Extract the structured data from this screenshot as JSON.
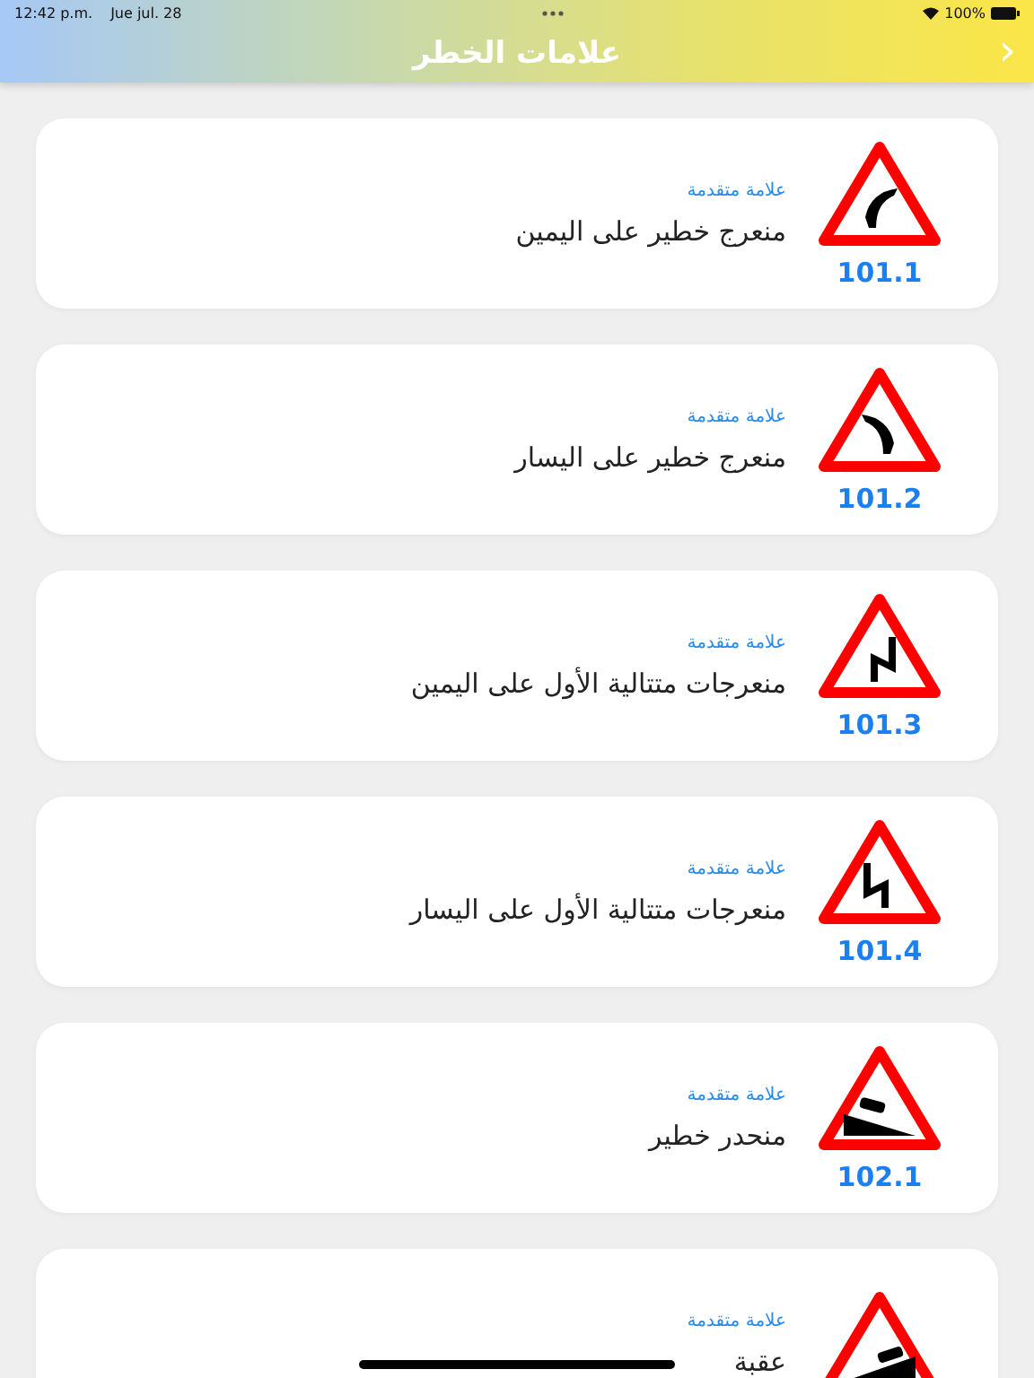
{
  "status_bar": {
    "time": "12:42 p.m.",
    "date": "Jue jul. 28",
    "battery": "100%"
  },
  "nav": {
    "title": "علامات الخطر",
    "back": "›"
  },
  "signs": [
    {
      "kind": "curve-right",
      "tag": "علامة متقدمة",
      "title": "منعرج خطير على اليمين",
      "code": "101.1"
    },
    {
      "kind": "curve-left",
      "tag": "علامة متقدمة",
      "title": "منعرج خطير على اليسار",
      "code": "101.2"
    },
    {
      "kind": "double-right",
      "tag": "علامة متقدمة",
      "title": "منعرجات متتالية الأول على اليمين",
      "code": "101.3"
    },
    {
      "kind": "double-left",
      "tag": "علامة متقدمة",
      "title": "منعرجات متتالية الأول على اليسار",
      "code": "101.4"
    },
    {
      "kind": "descent",
      "tag": "علامة متقدمة",
      "title": "منحدر خطير",
      "code": "102.1"
    },
    {
      "kind": "climb",
      "tag": "علامة متقدمة",
      "title": "عقبة"
    }
  ]
}
